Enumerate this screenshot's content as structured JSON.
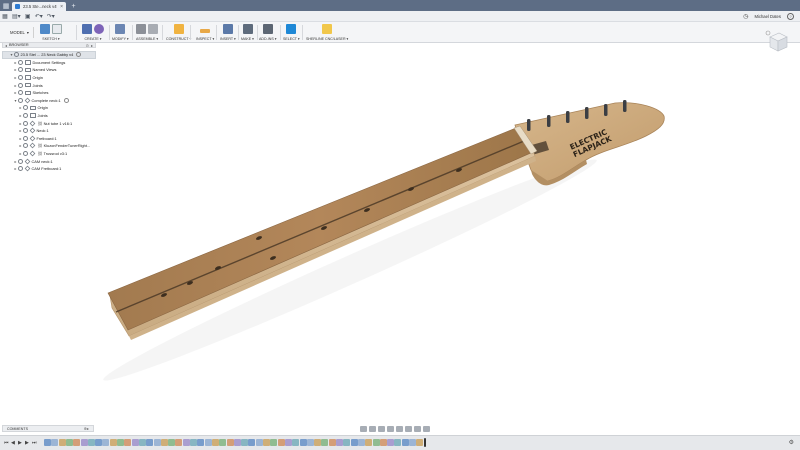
{
  "window": {
    "doc_tab": "23.5 Ste...neck v4*",
    "user_name": "Michael Dates",
    "colors": {
      "titlebar": "#5d6d85",
      "accent": "#1e88d6",
      "wood": "#b3875a",
      "board": "#8c6845"
    }
  },
  "toolbar": {
    "workspace": "MODEL",
    "groups": [
      {
        "label": "SKETCH ▾"
      },
      {
        "label": "CREATE ▾"
      },
      {
        "label": "MODIFY ▾"
      },
      {
        "label": "ASSEMBLE ▾"
      },
      {
        "label": "CONSTRUCT ▾"
      },
      {
        "label": "INSPECT ▾"
      },
      {
        "label": "INSERT ▾"
      },
      {
        "label": "MAKE ▾"
      },
      {
        "label": "ADD-INS ▾"
      },
      {
        "label": "SELECT ▾"
      },
      {
        "label": "SHERLINE CNC/LASER ▾"
      }
    ]
  },
  "browser": {
    "title": "BROWSER",
    "root_label": "23.5 Stel ... 23 Neck Gabby v4",
    "items": [
      {
        "label": "Document Settings",
        "icon": "gear-icon"
      },
      {
        "label": "Named Views",
        "icon": "folder-icon"
      },
      {
        "label": "Origin",
        "icon": "folder-icon"
      },
      {
        "label": "Joints",
        "icon": "folder-icon"
      },
      {
        "label": "Sketches",
        "icon": "folder-icon"
      },
      {
        "label": "Complete neck:1",
        "icon": "component-icon"
      },
      {
        "label": "Origin",
        "icon": "folder-icon"
      },
      {
        "label": "Joints",
        "icon": "folder-icon"
      },
      {
        "label": "Nut tube 1 v16:1",
        "icon": "component-icon"
      },
      {
        "label": "Neck:1",
        "icon": "component-icon"
      },
      {
        "label": "Fretboard:1",
        "icon": "component-icon"
      },
      {
        "label": "KluzonFenderTunerRight...",
        "icon": "component-icon"
      },
      {
        "label": "Trussrod v3:1",
        "icon": "component-icon"
      },
      {
        "label": "CAM neck:1",
        "icon": "component-icon"
      },
      {
        "label": "CAM Fretboard:1",
        "icon": "component-icon"
      }
    ]
  },
  "headstock_logo": [
    "ELECTRIC",
    "FLAPJACK"
  ],
  "comments_label": "COMMENTS"
}
